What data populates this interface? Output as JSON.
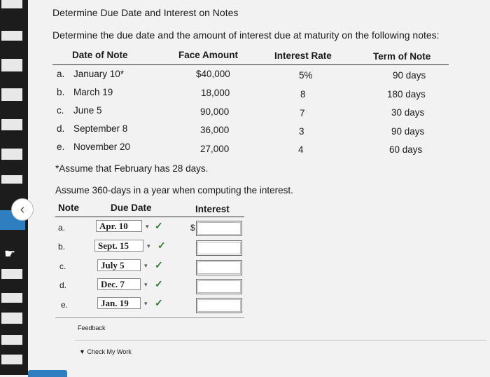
{
  "title": "Determine Due Date and Interest on Notes",
  "instructions": "Determine the due date and the amount of interest due at maturity on the following notes:",
  "notes_table": {
    "headers": [
      "Date of Note",
      "Face Amount",
      "Interest Rate",
      "Term of Note"
    ],
    "rows": [
      {
        "letter": "a.",
        "date": "January 10*",
        "amount": "$40,000",
        "rate": "5%",
        "term": "90 days"
      },
      {
        "letter": "b.",
        "date": "March 19",
        "amount": "18,000",
        "rate": "8",
        "term": "180 days"
      },
      {
        "letter": "c.",
        "date": "June 5",
        "amount": "90,000",
        "rate": "7",
        "term": "30 days"
      },
      {
        "letter": "d.",
        "date": "September 8",
        "amount": "36,000",
        "rate": "3",
        "term": "90 days"
      },
      {
        "letter": "e.",
        "date": "November 20",
        "amount": "27,000",
        "rate": "4",
        "term": "60 days"
      }
    ]
  },
  "footnote": "*Assume that February has 28 days.",
  "assumption": "Assume 360-days in a year when computing the interest.",
  "answer_table": {
    "headers": {
      "note": "Note",
      "due_date": "Due Date",
      "interest": "Interest"
    },
    "currency_symbol": "$",
    "rows": [
      {
        "letter": "a.",
        "due_date": "Apr. 10",
        "interest_value": ""
      },
      {
        "letter": "b.",
        "due_date": "Sept. 15",
        "interest_value": ""
      },
      {
        "letter": "c.",
        "due_date": "July 5",
        "interest_value": ""
      },
      {
        "letter": "d.",
        "due_date": "Dec. 7",
        "interest_value": ""
      },
      {
        "letter": "e.",
        "due_date": "Jan. 19",
        "interest_value": ""
      }
    ],
    "check_mark": "✓",
    "dropdown_arrow": "▾"
  },
  "feedback": {
    "label": "Feedback",
    "check_label": "Check My Work"
  },
  "icons": [
    "back-arrow-icon",
    "pointer-hand-icon",
    "checkmark-icon",
    "chevron-down-icon"
  ],
  "colors": {
    "check": "#2e7d32",
    "accent": "#2f7fc0"
  }
}
